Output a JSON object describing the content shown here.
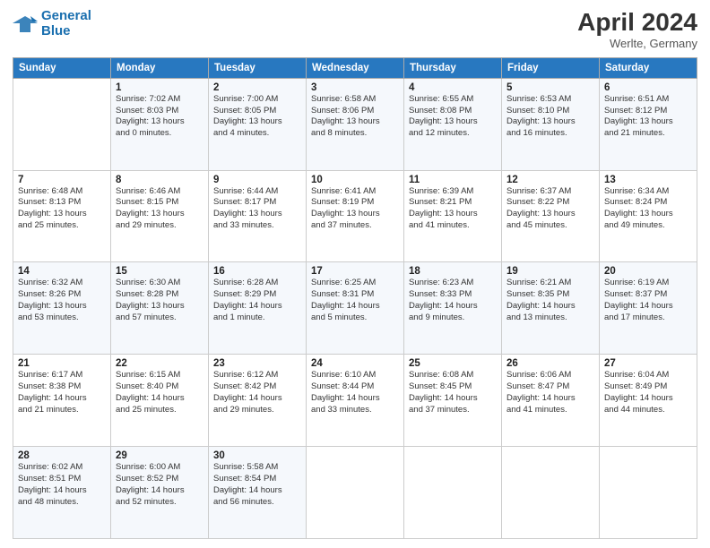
{
  "logo": {
    "line1": "General",
    "line2": "Blue"
  },
  "title": {
    "month": "April 2024",
    "location": "Werlte, Germany"
  },
  "weekdays": [
    "Sunday",
    "Monday",
    "Tuesday",
    "Wednesday",
    "Thursday",
    "Friday",
    "Saturday"
  ],
  "weeks": [
    [
      {
        "day": "",
        "info": ""
      },
      {
        "day": "1",
        "info": "Sunrise: 7:02 AM\nSunset: 8:03 PM\nDaylight: 13 hours\nand 0 minutes."
      },
      {
        "day": "2",
        "info": "Sunrise: 7:00 AM\nSunset: 8:05 PM\nDaylight: 13 hours\nand 4 minutes."
      },
      {
        "day": "3",
        "info": "Sunrise: 6:58 AM\nSunset: 8:06 PM\nDaylight: 13 hours\nand 8 minutes."
      },
      {
        "day": "4",
        "info": "Sunrise: 6:55 AM\nSunset: 8:08 PM\nDaylight: 13 hours\nand 12 minutes."
      },
      {
        "day": "5",
        "info": "Sunrise: 6:53 AM\nSunset: 8:10 PM\nDaylight: 13 hours\nand 16 minutes."
      },
      {
        "day": "6",
        "info": "Sunrise: 6:51 AM\nSunset: 8:12 PM\nDaylight: 13 hours\nand 21 minutes."
      }
    ],
    [
      {
        "day": "7",
        "info": "Sunrise: 6:48 AM\nSunset: 8:13 PM\nDaylight: 13 hours\nand 25 minutes."
      },
      {
        "day": "8",
        "info": "Sunrise: 6:46 AM\nSunset: 8:15 PM\nDaylight: 13 hours\nand 29 minutes."
      },
      {
        "day": "9",
        "info": "Sunrise: 6:44 AM\nSunset: 8:17 PM\nDaylight: 13 hours\nand 33 minutes."
      },
      {
        "day": "10",
        "info": "Sunrise: 6:41 AM\nSunset: 8:19 PM\nDaylight: 13 hours\nand 37 minutes."
      },
      {
        "day": "11",
        "info": "Sunrise: 6:39 AM\nSunset: 8:21 PM\nDaylight: 13 hours\nand 41 minutes."
      },
      {
        "day": "12",
        "info": "Sunrise: 6:37 AM\nSunset: 8:22 PM\nDaylight: 13 hours\nand 45 minutes."
      },
      {
        "day": "13",
        "info": "Sunrise: 6:34 AM\nSunset: 8:24 PM\nDaylight: 13 hours\nand 49 minutes."
      }
    ],
    [
      {
        "day": "14",
        "info": "Sunrise: 6:32 AM\nSunset: 8:26 PM\nDaylight: 13 hours\nand 53 minutes."
      },
      {
        "day": "15",
        "info": "Sunrise: 6:30 AM\nSunset: 8:28 PM\nDaylight: 13 hours\nand 57 minutes."
      },
      {
        "day": "16",
        "info": "Sunrise: 6:28 AM\nSunset: 8:29 PM\nDaylight: 14 hours\nand 1 minute."
      },
      {
        "day": "17",
        "info": "Sunrise: 6:25 AM\nSunset: 8:31 PM\nDaylight: 14 hours\nand 5 minutes."
      },
      {
        "day": "18",
        "info": "Sunrise: 6:23 AM\nSunset: 8:33 PM\nDaylight: 14 hours\nand 9 minutes."
      },
      {
        "day": "19",
        "info": "Sunrise: 6:21 AM\nSunset: 8:35 PM\nDaylight: 14 hours\nand 13 minutes."
      },
      {
        "day": "20",
        "info": "Sunrise: 6:19 AM\nSunset: 8:37 PM\nDaylight: 14 hours\nand 17 minutes."
      }
    ],
    [
      {
        "day": "21",
        "info": "Sunrise: 6:17 AM\nSunset: 8:38 PM\nDaylight: 14 hours\nand 21 minutes."
      },
      {
        "day": "22",
        "info": "Sunrise: 6:15 AM\nSunset: 8:40 PM\nDaylight: 14 hours\nand 25 minutes."
      },
      {
        "day": "23",
        "info": "Sunrise: 6:12 AM\nSunset: 8:42 PM\nDaylight: 14 hours\nand 29 minutes."
      },
      {
        "day": "24",
        "info": "Sunrise: 6:10 AM\nSunset: 8:44 PM\nDaylight: 14 hours\nand 33 minutes."
      },
      {
        "day": "25",
        "info": "Sunrise: 6:08 AM\nSunset: 8:45 PM\nDaylight: 14 hours\nand 37 minutes."
      },
      {
        "day": "26",
        "info": "Sunrise: 6:06 AM\nSunset: 8:47 PM\nDaylight: 14 hours\nand 41 minutes."
      },
      {
        "day": "27",
        "info": "Sunrise: 6:04 AM\nSunset: 8:49 PM\nDaylight: 14 hours\nand 44 minutes."
      }
    ],
    [
      {
        "day": "28",
        "info": "Sunrise: 6:02 AM\nSunset: 8:51 PM\nDaylight: 14 hours\nand 48 minutes."
      },
      {
        "day": "29",
        "info": "Sunrise: 6:00 AM\nSunset: 8:52 PM\nDaylight: 14 hours\nand 52 minutes."
      },
      {
        "day": "30",
        "info": "Sunrise: 5:58 AM\nSunset: 8:54 PM\nDaylight: 14 hours\nand 56 minutes."
      },
      {
        "day": "",
        "info": ""
      },
      {
        "day": "",
        "info": ""
      },
      {
        "day": "",
        "info": ""
      },
      {
        "day": "",
        "info": ""
      }
    ]
  ]
}
